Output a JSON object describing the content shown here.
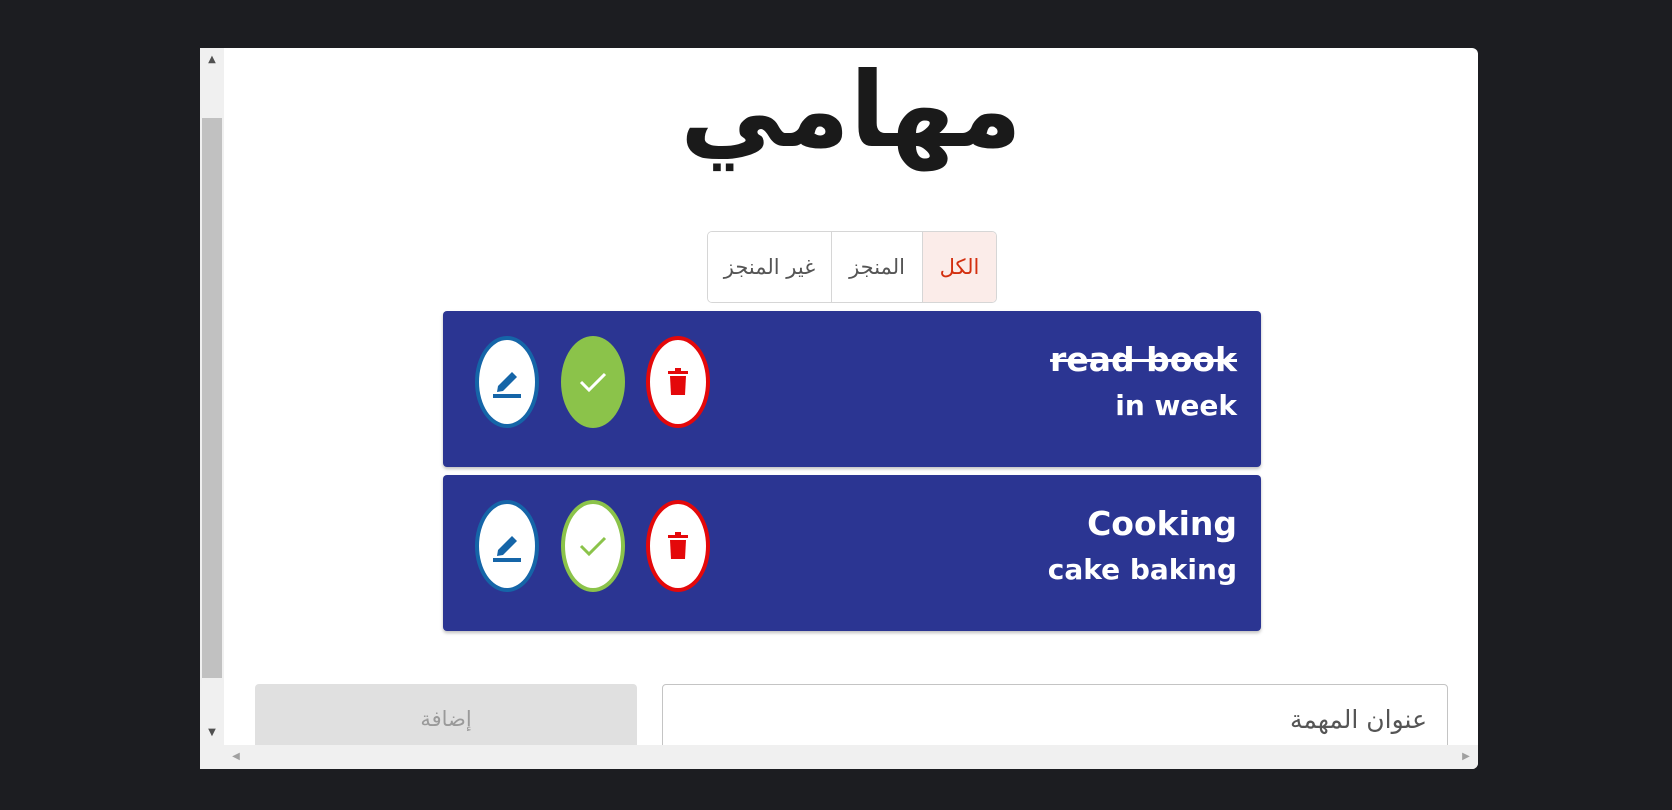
{
  "page": {
    "title": "مهامي"
  },
  "filters": [
    {
      "label": "الكل",
      "active": true
    },
    {
      "label": "المنجز",
      "active": false
    },
    {
      "label": "غير المنجز",
      "active": false
    }
  ],
  "tasks": [
    {
      "title": "read book",
      "description": "in week",
      "completed": true
    },
    {
      "title": "Cooking",
      "description": "cake baking",
      "completed": false
    }
  ],
  "form": {
    "add_label": "إضافة",
    "title_placeholder": "عنوان المهمة"
  },
  "colors": {
    "card": "#2b3592",
    "edit": "#1565a8",
    "check": "#8bc34a",
    "delete": "#e4080a",
    "filter_active": "#d32f0f"
  },
  "icons": {
    "edit": "pencil-icon",
    "check": "check-icon",
    "delete": "trash-icon"
  }
}
